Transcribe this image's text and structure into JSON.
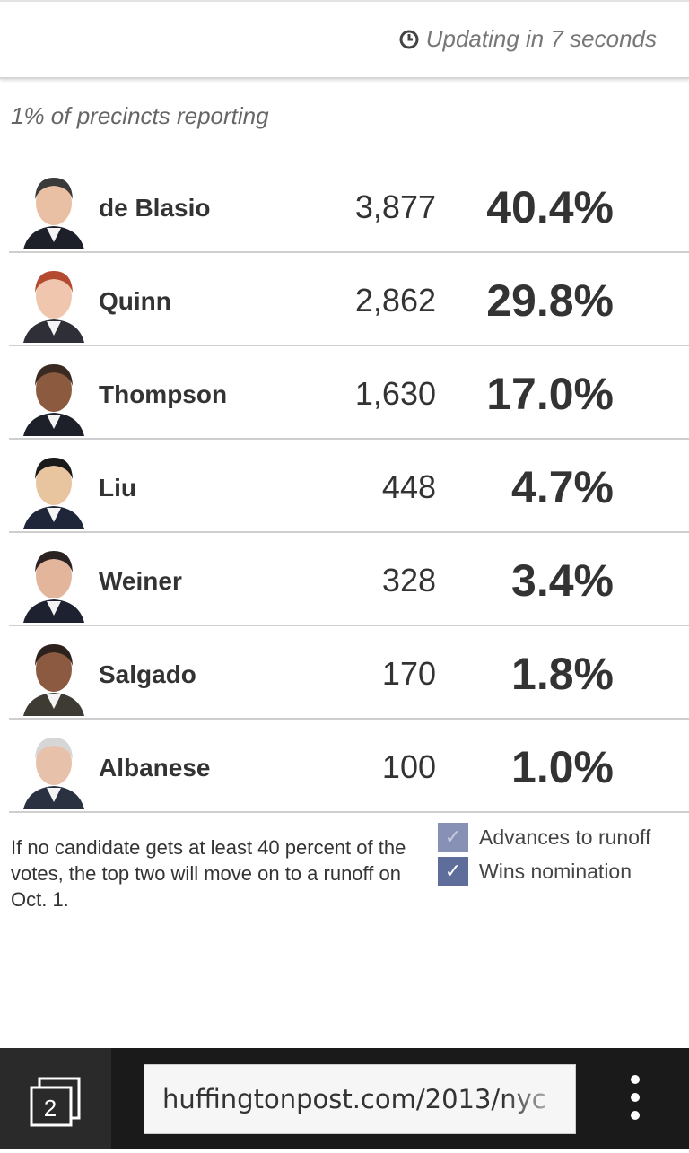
{
  "header": {
    "updating_text": "Updating in 7 seconds"
  },
  "precincts_text": "1% of precincts reporting",
  "candidates": [
    {
      "name": "de Blasio",
      "votes": "3,877",
      "pct": "40.4%",
      "skin": "#e9c0a4",
      "hair": "#3a3a3a",
      "suit": "#1d1f29"
    },
    {
      "name": "Quinn",
      "votes": "2,862",
      "pct": "29.8%",
      "skin": "#f0c7ae",
      "hair": "#b44a2f",
      "suit": "#2f2f37"
    },
    {
      "name": "Thompson",
      "votes": "1,630",
      "pct": "17.0%",
      "skin": "#8b5a3f",
      "hair": "#3a2a21",
      "suit": "#1d1f29"
    },
    {
      "name": "Liu",
      "votes": "448",
      "pct": "4.7%",
      "skin": "#e8c49f",
      "hair": "#1a1a1a",
      "suit": "#20263a"
    },
    {
      "name": "Weiner",
      "votes": "328",
      "pct": "3.4%",
      "skin": "#e3b69b",
      "hair": "#2b2222",
      "suit": "#1e2230"
    },
    {
      "name": "Salgado",
      "votes": "170",
      "pct": "1.8%",
      "skin": "#8c5a40",
      "hair": "#2c211c",
      "suit": "#3d3b33"
    },
    {
      "name": "Albanese",
      "votes": "100",
      "pct": "1.0%",
      "skin": "#e8c1aa",
      "hair": "#d6d6d6",
      "suit": "#2a3140"
    }
  ],
  "footer_note": "If no candidate gets at least 40 percent of the votes, the top two will move on to a runoff on Oct. 1.",
  "legend": {
    "advances": "Advances to runoff",
    "wins": "Wins nomination",
    "check": "✓"
  },
  "browser": {
    "tab_count": "2",
    "url": "huffingtonpost.com/2013/nyc"
  },
  "colors": {
    "checkbox": "#5f6d9a",
    "checkbox_light": "#8791b6"
  }
}
